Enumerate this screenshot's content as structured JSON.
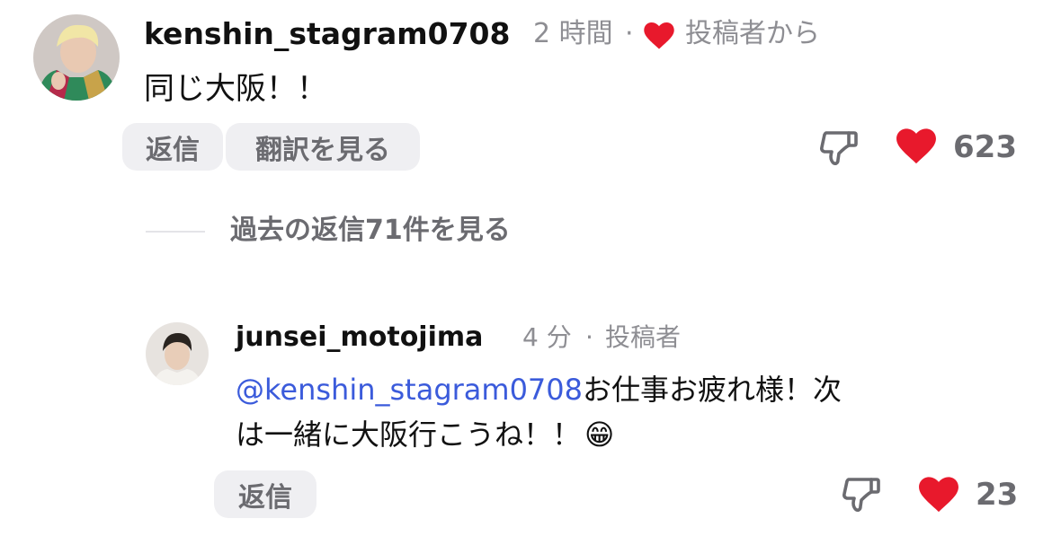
{
  "colors": {
    "heart": "#e8192c",
    "mention": "#3b5bdb",
    "meta": "#8e8e93",
    "pill_bg": "#efeff2"
  },
  "comment": {
    "username": "kenshin_stagram0708",
    "time": "2 時間",
    "separator": "·",
    "liked_by_author_label": "投稿者から",
    "liked_by_author_icon": "heart-icon",
    "text": "同じ大阪！！",
    "reply_label": "返信",
    "translate_label": "翻訳を見る",
    "dislike_icon": "thumbs-down-icon",
    "like_icon": "heart-icon",
    "like_count": "623"
  },
  "view_replies": {
    "label": "過去の返信71件を見る"
  },
  "reply": {
    "username": "junsei_motojima",
    "time": "4 分",
    "separator": "·",
    "author_badge": "投稿者",
    "mention": "@kenshin_stagram0708",
    "text_line1": "お仕事お疲れ様！次",
    "text_line2": "は一緒に大阪行こうね！！",
    "emoji": "😁",
    "reply_label": "返信",
    "dislike_icon": "thumbs-down-icon",
    "like_icon": "heart-icon",
    "like_count": "23"
  }
}
